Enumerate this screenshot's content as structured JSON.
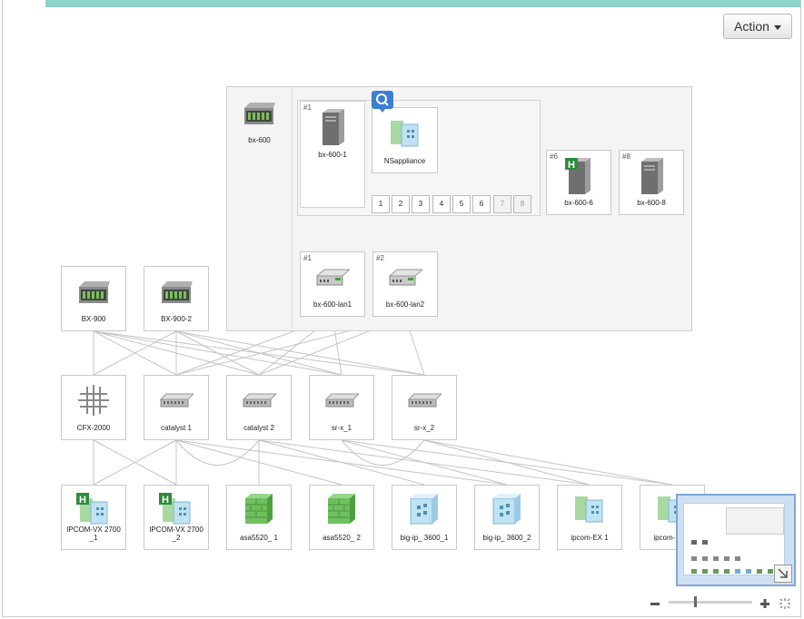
{
  "toolbar": {
    "action_label": "Action"
  },
  "chassis": {
    "label": "bx-600",
    "blade": {
      "index": "#1",
      "label": "bx-600-1"
    },
    "appliance": {
      "label": "NSappliance"
    },
    "slots": [
      "1",
      "2",
      "3",
      "4",
      "5",
      "6",
      "7",
      "8"
    ],
    "servers": [
      {
        "index": "#6",
        "label": "bx-600-6"
      },
      {
        "index": "#8",
        "label": "bx-600-8"
      }
    ],
    "lan_switches": [
      {
        "index": "#1",
        "label": "bx-600-lan1"
      },
      {
        "index": "#2",
        "label": "bx-600-lan2"
      }
    ]
  },
  "top_servers": [
    {
      "label": "BX-900"
    },
    {
      "label": "BX-900-2"
    }
  ],
  "switches": [
    {
      "label": "CFX-2000"
    },
    {
      "label": "catalyst 1"
    },
    {
      "label": "catalyst 2"
    },
    {
      "label": "sr-x_1"
    },
    {
      "label": "sr-x_2"
    }
  ],
  "appliances": [
    {
      "label": "IPCOM-VX 2700_1"
    },
    {
      "label": "IPCOM-VX 2700_2"
    },
    {
      "label": "asa5520_ 1"
    },
    {
      "label": "asa5520_ 2"
    },
    {
      "label": "big-ip_ 3600_1"
    },
    {
      "label": "big-ip_ 3600_2"
    },
    {
      "label": "ipcom-EX 1"
    },
    {
      "label": "ipcom-EX 2"
    }
  ],
  "zoom": {
    "level": 0.3
  },
  "colors": {
    "accent": "#8dd3c6",
    "minimap_border": "#7fa6d6",
    "badge": "#3a7fd5"
  }
}
